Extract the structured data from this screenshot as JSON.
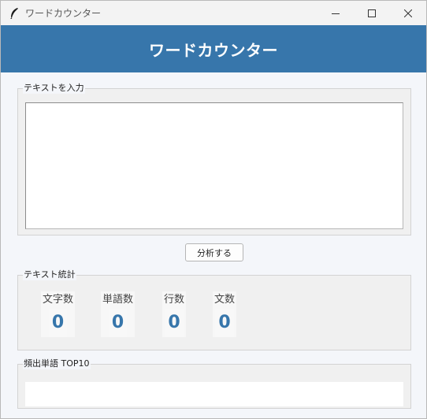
{
  "window": {
    "title": "ワードカウンター",
    "minimize_icon": "minimize-icon",
    "maximize_icon": "maximize-icon",
    "close_icon": "close-icon"
  },
  "header": {
    "title": "ワードカウンター"
  },
  "input_section": {
    "legend": "テキストを入力",
    "text_value": ""
  },
  "analyze_button": {
    "label": "分析する"
  },
  "stats_section": {
    "legend": "テキスト統計",
    "items": [
      {
        "label": "文字数",
        "value": "0"
      },
      {
        "label": "単語数",
        "value": "0"
      },
      {
        "label": "行数",
        "value": "0"
      },
      {
        "label": "文数",
        "value": "0"
      }
    ]
  },
  "top_words_section": {
    "legend": "頻出単語 TOP10",
    "items": []
  },
  "colors": {
    "header_bg": "#3776ab",
    "stat_value": "#3776ab"
  }
}
